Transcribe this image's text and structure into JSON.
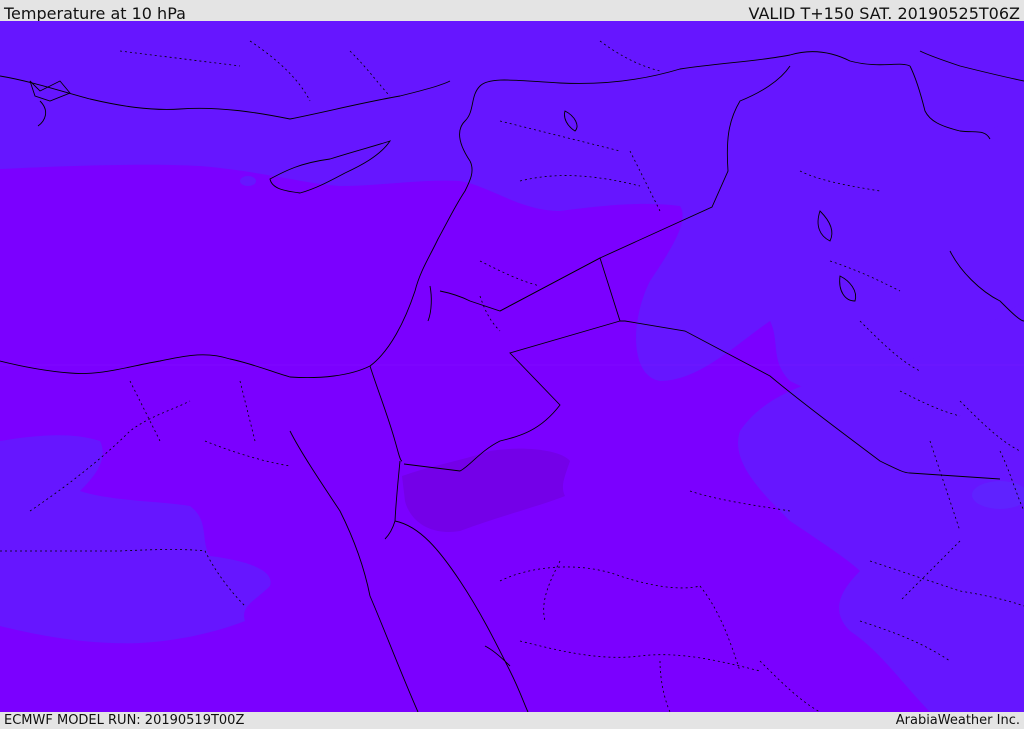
{
  "header": {
    "title": "Temperature at 10 hPa",
    "valid": "VALID T+150 SAT. 20190525T06Z"
  },
  "footer": {
    "model_run": "ECMWF MODEL RUN: 20190519T00Z",
    "brand": "ArabiaWeather Inc."
  },
  "map": {
    "region": "Eastern Mediterranean / Middle East",
    "colors": {
      "base_field": "#7b00ff",
      "cooler_field": "#6616ff",
      "warm_patch": "#7400e8",
      "border_line": "#000000"
    },
    "layers": [
      "temperature-shading",
      "coastlines",
      "country-borders",
      "province-borders"
    ]
  }
}
